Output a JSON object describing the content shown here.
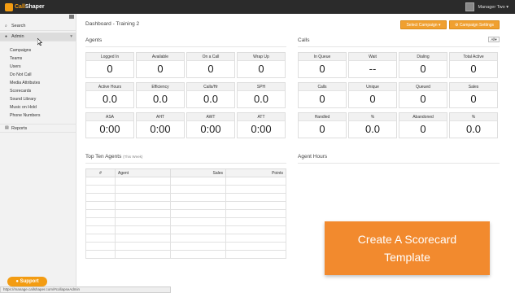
{
  "topbar": {
    "logo_word1": "Call",
    "logo_word2": "Shaper",
    "user_name": "Manager Two",
    "user_caret": "▾"
  },
  "sidebar": {
    "search": "Search",
    "admin": "Admin",
    "admin_items": [
      "Campaigns",
      "Teams",
      "Users",
      "Do Not Call",
      "Media Attributes",
      "Scorecards",
      "Sound Library",
      "Music on Hold",
      "Phone Numbers"
    ],
    "reports": "Reports"
  },
  "support_label": "Support",
  "status_url": "https://manage.callshaper.com/#collapseAdmin",
  "header": {
    "title": "Dashboard - Training 2",
    "select_campaign": "Select Campaign",
    "campaign_settings": "Campaign Settings"
  },
  "agents": {
    "title": "Agents",
    "cards": [
      {
        "label": "Logged In",
        "value": "0"
      },
      {
        "label": "Available",
        "value": "0"
      },
      {
        "label": "On a Call",
        "value": "0"
      },
      {
        "label": "Wrap Up",
        "value": "0"
      },
      {
        "label": "Active Hours",
        "value": "0.0"
      },
      {
        "label": "Efficiency",
        "value": "0.0"
      },
      {
        "label": "Calls/Hr",
        "value": "0.0"
      },
      {
        "label": "SPH",
        "value": "0.0"
      },
      {
        "label": "ASA",
        "value": "0:00"
      },
      {
        "label": "AHT",
        "value": "0:00"
      },
      {
        "label": "AWT",
        "value": "0:00"
      },
      {
        "label": "ATT",
        "value": "0:00"
      }
    ]
  },
  "calls": {
    "title": "Calls",
    "filter": "All",
    "cards": [
      {
        "label": "In Queue",
        "value": "0"
      },
      {
        "label": "Wait",
        "value": "--"
      },
      {
        "label": "Dialing",
        "value": "0"
      },
      {
        "label": "Total Active",
        "value": "0"
      },
      {
        "label": "Calls",
        "value": "0"
      },
      {
        "label": "Unique",
        "value": "0"
      },
      {
        "label": "Queued",
        "value": "0"
      },
      {
        "label": "Sales",
        "value": "0"
      },
      {
        "label": "Handled",
        "value": "0"
      },
      {
        "label": "%",
        "value": "0.0"
      },
      {
        "label": "Abandoned",
        "value": "0"
      },
      {
        "label": "%",
        "value": "0.0"
      }
    ]
  },
  "top_agents": {
    "title": "Top Ten Agents",
    "subtitle": "(This Week)",
    "columns": [
      "#",
      "Agent",
      "Sales",
      "Points"
    ]
  },
  "agent_hours": {
    "title": "Agent Hours"
  },
  "overlay": {
    "line1": "Create A Scorecard",
    "line2": "Template"
  }
}
